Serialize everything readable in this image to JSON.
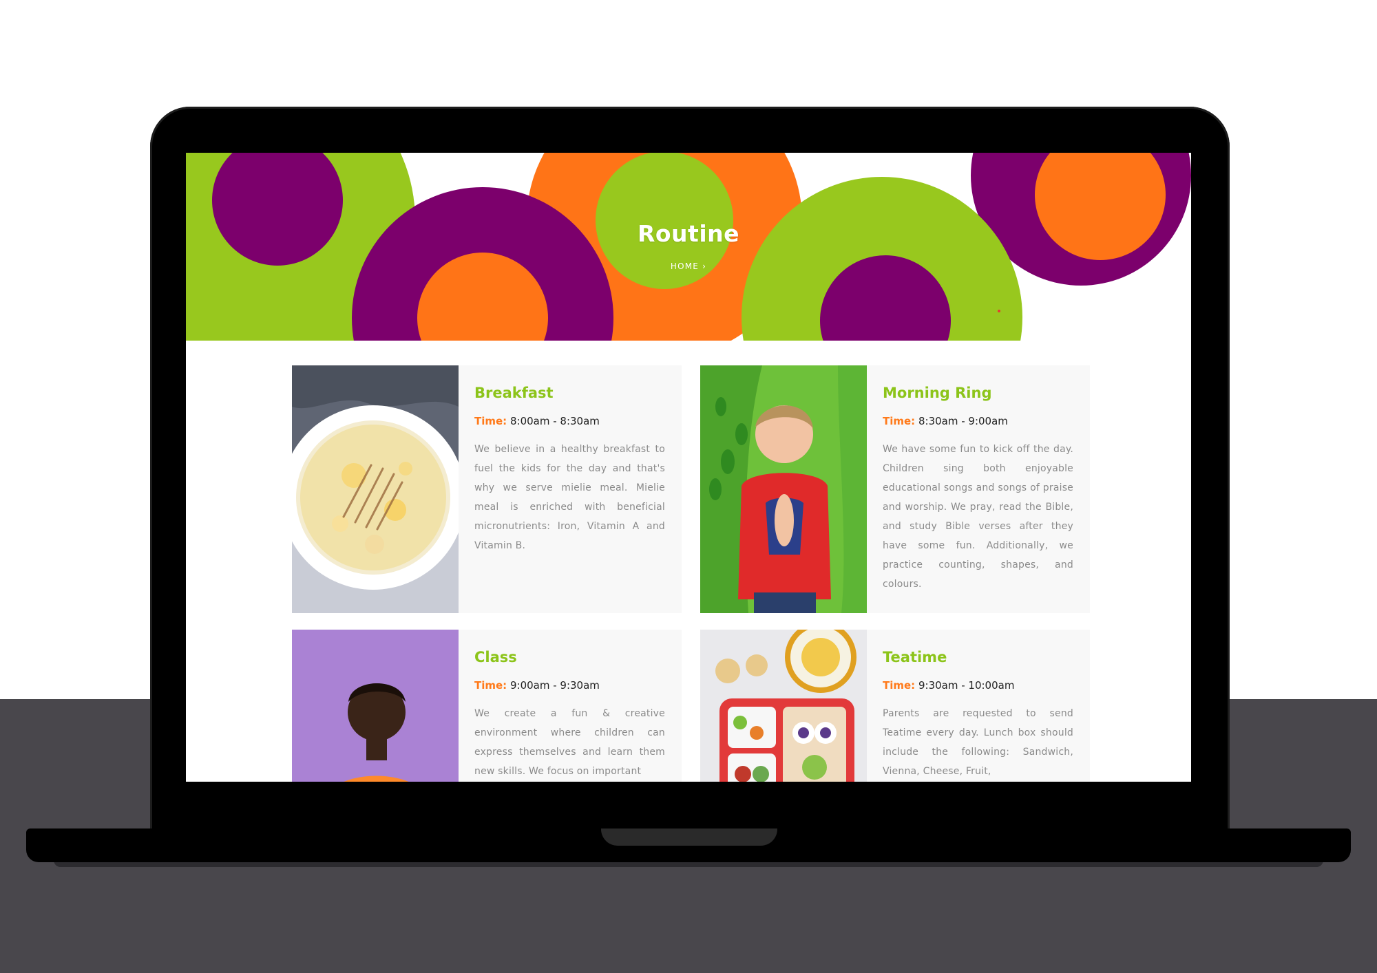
{
  "colors": {
    "green": "#98c81e",
    "purple": "#7c006c",
    "orange": "#ff7417",
    "title_green": "#8cc41a",
    "time_label_orange": "#ff7a1a",
    "desk_gray": "#49474c"
  },
  "hero": {
    "title": "Routine",
    "breadcrumb": "HOME",
    "breadcrumb_icon": "chevron-right-icon",
    "breadcrumb_glyph": "›"
  },
  "cards": [
    {
      "title": "Breakfast",
      "time_label": "Time:",
      "time_value": "8:00am - 8:30am",
      "description": "We believe in a healthy breakfast to fuel the kids for the day and that's why we serve mielie meal. Mielie meal is enriched with beneficial micronutrients: Iron, Vitamin A and Vitamin B.",
      "image": "bowl-of-mielie-meal-photo"
    },
    {
      "title": "Morning Ring",
      "time_label": "Time:",
      "time_value": "8:30am - 9:00am",
      "description": "We have some fun to kick off the day. Children sing both enjoyable educational songs and songs of praise and worship. We pray, read the Bible, and study Bible verses after they have some fun. Additionally, we practice counting, shapes, and colours.",
      "image": "child-praying-photo"
    },
    {
      "title": "Class",
      "time_label": "Time:",
      "time_value": "9:00am - 9:30am",
      "description": "We create a fun & creative environment where children can express themselves and learn them new skills. We focus on important",
      "image": "child-learning-photo"
    },
    {
      "title": "Teatime",
      "time_label": "Time:",
      "time_value": "9:30am - 10:00am",
      "description": "Parents are requested to send Teatime every day. Lunch box should include the following: Sandwich, Vienna, Cheese, Fruit,",
      "image": "lunch-box-photo"
    }
  ]
}
